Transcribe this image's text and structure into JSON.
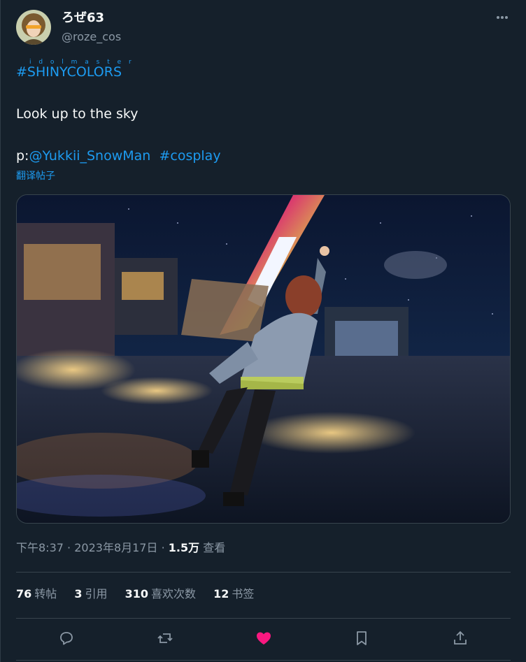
{
  "author": {
    "display_name": "ろぜ63",
    "handle": "@roze_cos"
  },
  "tweet": {
    "ruby_text": "i d o l m a s t e r",
    "hashtag": "#SHINYCOLORS",
    "body": "Look up to the sky",
    "credit_prefix": "p:",
    "credit_mention": "@Yukkii_SnowMan",
    "credit_hashtag": "#cosplay",
    "translate_label": "翻译帖子"
  },
  "meta": {
    "time": "下午8:37",
    "date": "2023年8月17日",
    "views_count": "1.5万",
    "views_label": "查看",
    "separator": "·"
  },
  "stats": [
    {
      "count": "76",
      "label": "转帖"
    },
    {
      "count": "3",
      "label": "引用"
    },
    {
      "count": "310",
      "label": "喜欢次数"
    },
    {
      "count": "12",
      "label": "书签"
    }
  ],
  "actions": {
    "reply_icon": "speech-bubble-icon",
    "retweet_icon": "retweet-icon",
    "like_icon": "heart-icon",
    "bookmark_icon": "bookmark-icon",
    "share_icon": "share-icon",
    "liked": true
  },
  "colors": {
    "background": "#15202b",
    "link": "#1d9bf0",
    "muted": "#8b98a5",
    "like": "#f91880",
    "divider": "#38444d"
  }
}
